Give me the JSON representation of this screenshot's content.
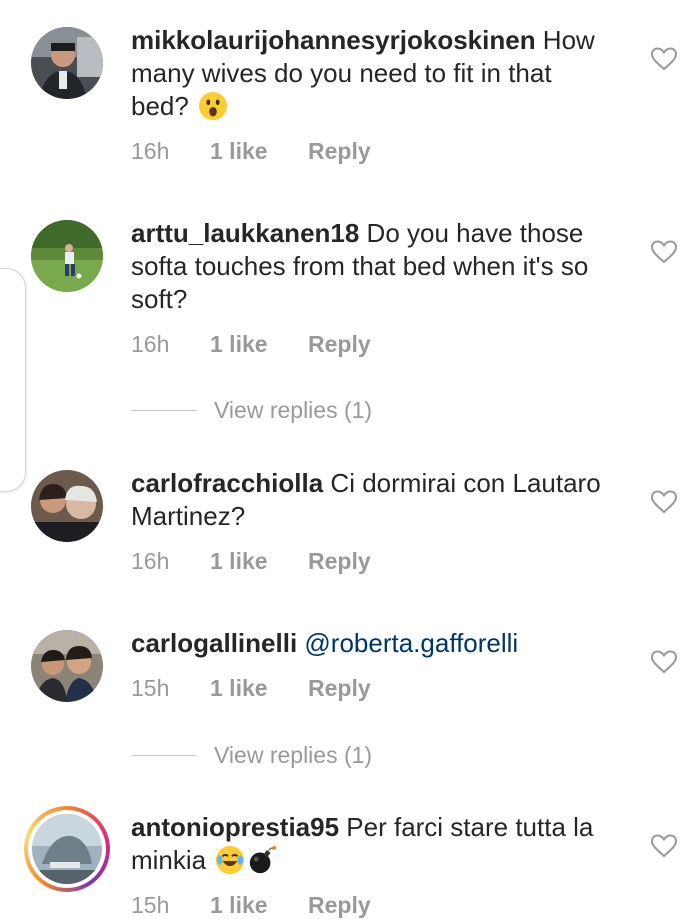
{
  "comments": [
    {
      "username": "mikkolaurijohannesyrjokoskinen",
      "text": " How many wives do you need to fit in that bed?",
      "time": "16h",
      "likes": "1 like",
      "reply": "Reply",
      "emoji": "astonished-face-emoji"
    },
    {
      "username": "arttu_laukkanen18",
      "text": " Do you have those softa touches from that bed when it's so soft?",
      "time": "16h",
      "likes": "1 like",
      "reply": "Reply",
      "view_replies": "View replies (1)"
    },
    {
      "username": "carlofracchiolla",
      "text": " Ci dormirai con Lautaro Martinez?",
      "time": "16h",
      "likes": "1 like",
      "reply": "Reply"
    },
    {
      "username": "carlogallinelli",
      "mention": "@roberta.gafforelli",
      "time": "15h",
      "likes": "1 like",
      "reply": "Reply",
      "view_replies": "View replies (1)"
    },
    {
      "username": "antonioprestia95",
      "text": " Per farci stare tutta la minkia",
      "time": "15h",
      "likes": "1 like",
      "reply": "Reply",
      "emoji": [
        "laughing-tears-emoji",
        "bomb-emoji"
      ]
    }
  ],
  "colors": {
    "text": "#262626",
    "secondary": "#999999",
    "mention": "#003569",
    "divider": "#c7c7c7"
  }
}
